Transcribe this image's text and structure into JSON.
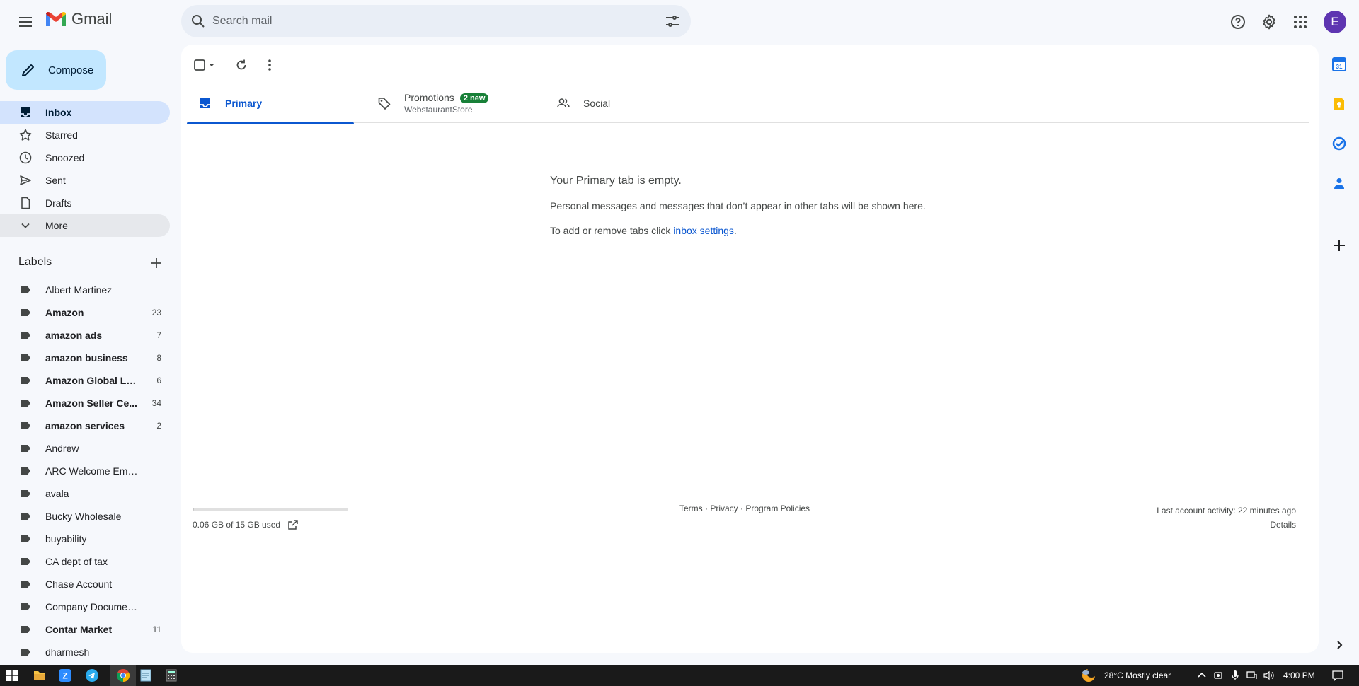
{
  "app": {
    "name": "Gmail",
    "avatar_letter": "E"
  },
  "search": {
    "placeholder": "Search mail"
  },
  "compose": {
    "label": "Compose"
  },
  "nav": [
    {
      "label": "Inbox",
      "icon": "inbox-icon"
    },
    {
      "label": "Starred",
      "icon": "star-icon"
    },
    {
      "label": "Snoozed",
      "icon": "clock-icon"
    },
    {
      "label": "Sent",
      "icon": "send-icon"
    },
    {
      "label": "Drafts",
      "icon": "draft-icon"
    },
    {
      "label": "More",
      "icon": "chevron-down-icon"
    }
  ],
  "labels": {
    "title": "Labels",
    "items": [
      {
        "name": "Albert Martinez",
        "count": ""
      },
      {
        "name": "Amazon",
        "count": "23"
      },
      {
        "name": "amazon ads",
        "count": "7"
      },
      {
        "name": "amazon business",
        "count": "8"
      },
      {
        "name": "Amazon Global Lo...",
        "count": "6"
      },
      {
        "name": "Amazon Seller Ce...",
        "count": "34"
      },
      {
        "name": "amazon services",
        "count": "2"
      },
      {
        "name": "Andrew",
        "count": ""
      },
      {
        "name": "ARC Welcome Emails",
        "count": ""
      },
      {
        "name": "avala",
        "count": ""
      },
      {
        "name": "Bucky Wholesale",
        "count": ""
      },
      {
        "name": "buyability",
        "count": ""
      },
      {
        "name": "CA dept of tax",
        "count": ""
      },
      {
        "name": "Chase Account",
        "count": ""
      },
      {
        "name": "Company Documents",
        "count": ""
      },
      {
        "name": "Contar Market",
        "count": "11"
      },
      {
        "name": "dharmesh",
        "count": ""
      }
    ]
  },
  "tabs": {
    "primary": {
      "label": "Primary"
    },
    "promotions": {
      "label": "Promotions",
      "badge": "2 new",
      "sub": "WebstaurantStore"
    },
    "social": {
      "label": "Social"
    }
  },
  "empty": {
    "title": "Your Primary tab is empty.",
    "line1": "Personal messages and messages that don’t appear in other tabs will be shown here.",
    "line2_prefix": "To add or remove tabs click ",
    "line2_link": "inbox settings",
    "line2_suffix": "."
  },
  "footer": {
    "storage": "0.06 GB of 15 GB used",
    "storage_fraction": 0.004,
    "links": "Terms · Privacy · Program Policies",
    "activity": "Last account activity: 22 minutes ago",
    "details": "Details"
  },
  "taskbar": {
    "weather": "28°C  Mostly clear",
    "time": "4:00 PM"
  }
}
